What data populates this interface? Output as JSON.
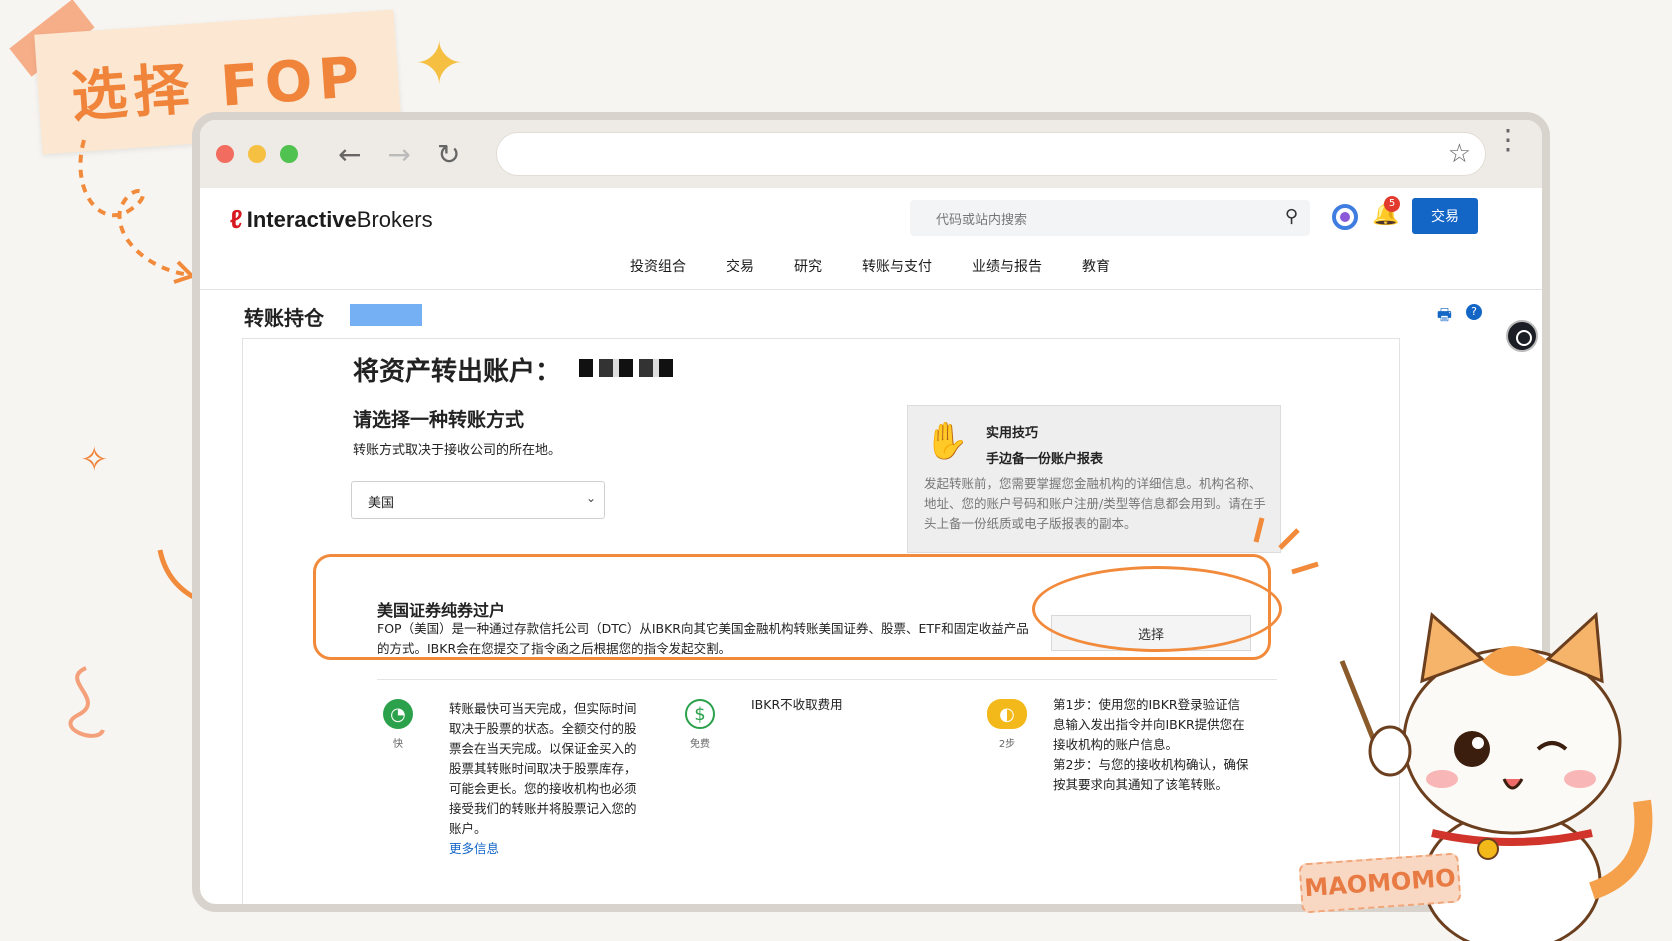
{
  "annotation": {
    "sticker_text": "选择 FOP",
    "badge_text": "MAOMOMO"
  },
  "browser": {
    "nav_back": "←",
    "nav_forward": "→",
    "nav_refresh": "↻",
    "star": "☆",
    "menu": "⋮"
  },
  "header": {
    "logo_mark": "ℓ",
    "logo_bold": "Interactive",
    "logo_light": "Brokers",
    "search_placeholder": "代码或站内搜索",
    "notification_count": "5",
    "trade_button": "交易",
    "nav": [
      "投资组合",
      "交易",
      "研究",
      "转账与支付",
      "业绩与报告",
      "教育"
    ]
  },
  "page": {
    "title": "转账持仓",
    "help_icon": "?"
  },
  "card": {
    "title": "将资产转出账户：",
    "method_title": "请选择一种转账方式",
    "method_sub": "转账方式取决于接收公司的所在地。",
    "country_selected": "美国",
    "tip": {
      "label": "实用技巧",
      "heading": "手边备一份账户报表",
      "body": "发起转账前，您需要掌握您金融机构的详细信息。机构名称、地址、您的账户号码和账户注册/类型等信息都会用到。请在手头上备一份纸质或电子版报表的副本。"
    },
    "fop": {
      "title": "美国证券纯券过户",
      "description": "FOP（美国）是一种通过存款信托公司（DTC）从IBKR向其它美国金融机构转账美国证券、股票、ETF和固定收益产品的方式。IBKR会在您提交了指令函之后根据您的指令发起交割。",
      "select_button": "选择"
    },
    "features": {
      "speed_label": "快",
      "speed_text": "转账最快可当天完成，但实际时间取决于股票的状态。全额交付的股票会在当天完成。以保证金买入的股票其转账时间取决于股票库存，可能会更长。您的接收机构也必须接受我们的转账并将股票记入您的账户。",
      "more_info": "更多信息",
      "fee_label": "免费",
      "fee_text": "IBKR不收取费用",
      "steps_label": "2步",
      "step1": "第1步：使用您的IBKR登录验证信息输入发出指令并向IBKR提供您在接收机构的账户信息。",
      "step2": "第2步：与您的接收机构确认，确保按其要求向其通知了该笔转账。"
    }
  },
  "colors": {
    "accent_orange": "#f28a3c",
    "ib_blue": "#1466c6",
    "ib_red": "#d71920"
  }
}
